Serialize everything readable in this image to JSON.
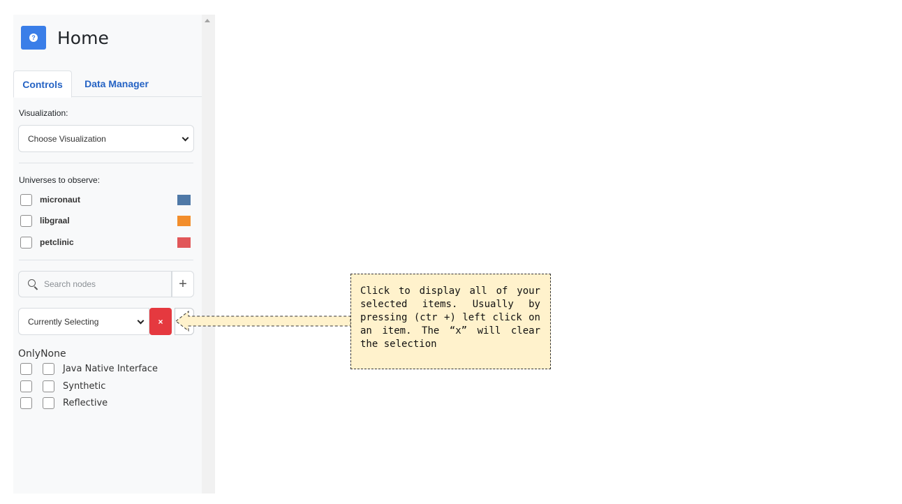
{
  "header": {
    "title": "Home",
    "icon": "help-circle-icon"
  },
  "tabs": [
    {
      "label": "Controls",
      "active": true
    },
    {
      "label": "Data Manager",
      "active": false
    }
  ],
  "visualization": {
    "label": "Visualization:",
    "value": "Choose Visualization"
  },
  "universes": {
    "label": "Universes to observe:",
    "items": [
      {
        "label": "micronaut",
        "color": "#4f79a7"
      },
      {
        "label": "libgraal",
        "color": "#f28e2c"
      },
      {
        "label": "petclinic",
        "color": "#e15759"
      }
    ]
  },
  "search": {
    "placeholder": "Search nodes",
    "add_label": "+"
  },
  "selection": {
    "value": "Currently Selecting",
    "clear_label": "×"
  },
  "filters": {
    "header": "OnlyNone",
    "items": [
      {
        "label": "Java Native Interface"
      },
      {
        "label": "Synthetic"
      },
      {
        "label": "Reflective"
      }
    ]
  },
  "callout": {
    "text": "Click to display all of your selected items. Usually by pressing (ctr +) left click on an item. The “x” will clear the selection"
  }
}
